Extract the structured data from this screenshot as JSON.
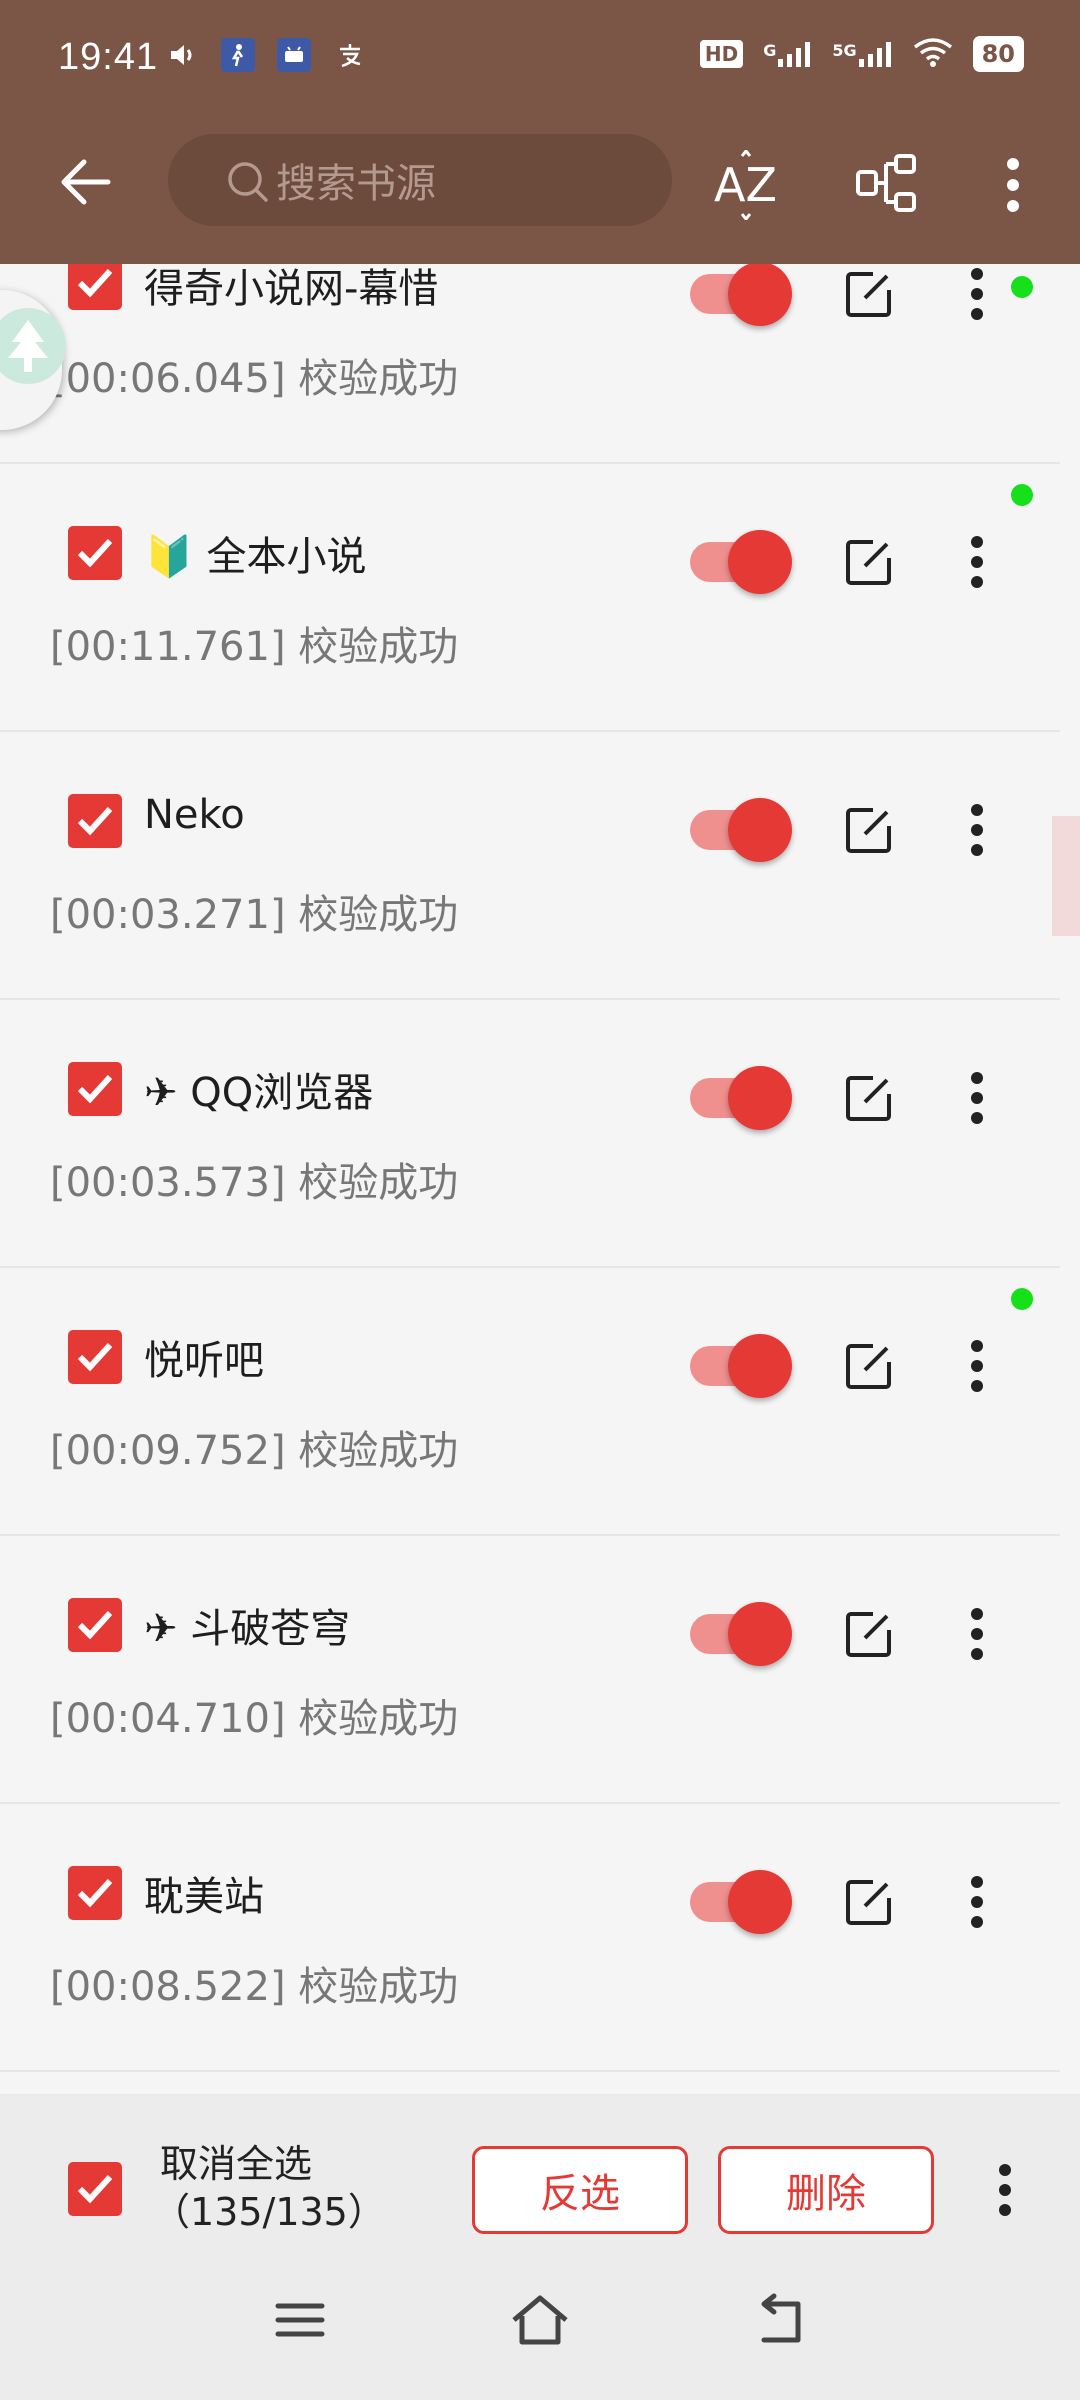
{
  "status_bar": {
    "time": "19:41",
    "left_icons": [
      "sound-icon",
      "walk-icon",
      "android-icon",
      "alipay-icon"
    ],
    "right_labels": {
      "hd": "HD",
      "sig1": "G",
      "sig2": "5G",
      "battery": "80"
    }
  },
  "toolbar": {
    "search_placeholder": "搜索书源",
    "sort_label": "AZ"
  },
  "sources": [
    {
      "name": "得奇小说网-幕惜",
      "status": "[00:06.045] 校验成功",
      "checked": true,
      "enabled": true,
      "dot": true
    },
    {
      "name": "🔰 全本小说",
      "status": "[00:11.761] 校验成功",
      "checked": true,
      "enabled": true,
      "dot": true
    },
    {
      "name": "Neko",
      "status": "[00:03.271] 校验成功",
      "checked": true,
      "enabled": true,
      "dot": false
    },
    {
      "name": "✈ QQ浏览器",
      "status": "[00:03.573] 校验成功",
      "checked": true,
      "enabled": true,
      "dot": false
    },
    {
      "name": "悦听吧",
      "status": "[00:09.752] 校验成功",
      "checked": true,
      "enabled": true,
      "dot": true
    },
    {
      "name": "✈ 斗破苍穹",
      "status": "[00:04.710] 校验成功",
      "checked": true,
      "enabled": true,
      "dot": false
    },
    {
      "name": "耽美站",
      "status": "[00:08.522] 校验成功",
      "checked": true,
      "enabled": true,
      "dot": false
    }
  ],
  "bottom": {
    "select_label": "取消全选",
    "count": "（135/135）",
    "invert_label": "反选",
    "delete_label": "删除"
  },
  "colors": {
    "appbar": "#7b5546",
    "accent": "#e53935",
    "dot": "#16e01a"
  }
}
